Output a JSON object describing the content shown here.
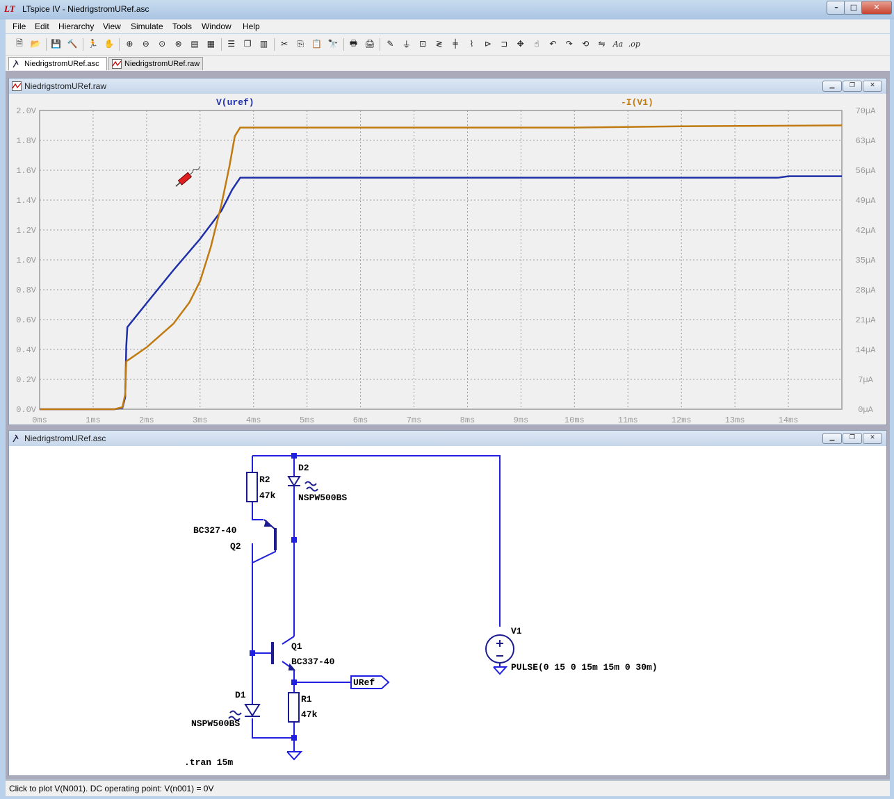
{
  "window": {
    "title": "LTspice IV - NiedrigstromURef.asc",
    "buttons": {
      "minimize": "–",
      "maximize": "□",
      "close": "✕"
    }
  },
  "menu": [
    "File",
    "Edit",
    "Hierarchy",
    "View",
    "Simulate",
    "Tools",
    "Window",
    "Help"
  ],
  "toolbar_icons": [
    "new-schematic-icon",
    "open-icon",
    "save-icon",
    "control-panel-icon",
    "run-icon",
    "halt-icon",
    "zoom-in-icon",
    "zoom-out-icon",
    "zoom-fit-icon",
    "zoom-cancel-icon",
    "autorange-icon",
    "grid-icon",
    "tile-horizontal-icon",
    "cascade-icon",
    "tile-vertical-icon",
    "cut-icon",
    "copy-icon",
    "paste-icon",
    "find-icon",
    "print-preview-icon",
    "print-icon",
    "wire-icon",
    "ground-icon",
    "label-net-icon",
    "resistor-icon",
    "capacitor-icon",
    "inductor-icon",
    "diode-icon",
    "component-icon",
    "move-icon",
    "drag-icon",
    "undo-icon",
    "redo-icon",
    "rotate-icon",
    "mirror-icon",
    "text-icon",
    "spice-directive-icon"
  ],
  "tabs": [
    "NiedrigstromURef.asc",
    "NiedrigstromURef.raw"
  ],
  "plot_window": {
    "title": "NiedrigstromURef.raw",
    "trace_labels": [
      "V(uref)",
      "-I(V1)"
    ],
    "colors": {
      "vuref": "#1f2fa8",
      "iv1": "#c07a10",
      "grid": "#9a9a9a",
      "axis_text": "#9a9a9a"
    }
  },
  "chart_data": {
    "type": "line",
    "title": "",
    "xlabel": "",
    "x_ticks": [
      "0ms",
      "1ms",
      "2ms",
      "3ms",
      "4ms",
      "5ms",
      "6ms",
      "7ms",
      "8ms",
      "9ms",
      "10ms",
      "11ms",
      "12ms",
      "13ms",
      "14ms"
    ],
    "y_left_ticks": [
      "0.0V",
      "0.2V",
      "0.4V",
      "0.6V",
      "0.8V",
      "1.0V",
      "1.2V",
      "1.4V",
      "1.6V",
      "1.8V",
      "2.0V"
    ],
    "y_right_ticks": [
      "0µA",
      "7µA",
      "14µA",
      "21µA",
      "28µA",
      "35µA",
      "42µA",
      "49µA",
      "56µA",
      "63µA",
      "70µA"
    ],
    "xlim_ms": [
      0,
      15
    ],
    "ylim_left_V": [
      0,
      2.0
    ],
    "ylim_right_uA": [
      0,
      70
    ],
    "grid": true,
    "series": [
      {
        "name": "V(uref)",
        "axis": "left",
        "color": "#1f2fa8",
        "points": [
          [
            0,
            0
          ],
          [
            1.4,
            0
          ],
          [
            1.55,
            0.01
          ],
          [
            1.6,
            0.08
          ],
          [
            1.62,
            0.42
          ],
          [
            1.64,
            0.55
          ],
          [
            2,
            0.71
          ],
          [
            2.5,
            0.93
          ],
          [
            3,
            1.14
          ],
          [
            3.4,
            1.33
          ],
          [
            3.6,
            1.47
          ],
          [
            3.75,
            1.55
          ],
          [
            6,
            1.55
          ],
          [
            10,
            1.55
          ],
          [
            13.8,
            1.55
          ],
          [
            14,
            1.56
          ],
          [
            15,
            1.56
          ]
        ]
      },
      {
        "name": "-I(V1)",
        "axis": "right",
        "color": "#c07a10",
        "points": [
          [
            0,
            0
          ],
          [
            1.4,
            0
          ],
          [
            1.55,
            0.5
          ],
          [
            1.6,
            3.5
          ],
          [
            1.62,
            11.2
          ],
          [
            2,
            14.5
          ],
          [
            2.5,
            20
          ],
          [
            2.8,
            25
          ],
          [
            3,
            30
          ],
          [
            3.2,
            38
          ],
          [
            3.4,
            48
          ],
          [
            3.55,
            57
          ],
          [
            3.65,
            64
          ],
          [
            3.75,
            66
          ],
          [
            6,
            66
          ],
          [
            10,
            66
          ],
          [
            12,
            66.3
          ],
          [
            15,
            66.5
          ]
        ]
      }
    ]
  },
  "schematic_window": {
    "title": "NiedrigstromURef.asc",
    "labels": {
      "r2_name": "R2",
      "r2_value": "47k",
      "d2_name": "D2",
      "d2_model": "NSPW500BS",
      "q2_model": "BC327-40",
      "q2_name": "Q2",
      "q1_name": "Q1",
      "q1_model": "BC337-40",
      "uref_label": "URef",
      "v1_name": "V1",
      "v1_value": "PULSE(0 15 0 15m 15m 0 30m)",
      "d1_name": "D1",
      "d1_model": "NSPW500BS",
      "r1_name": "R1",
      "r1_value": "47k",
      "directive": ".tran 15m"
    },
    "colors": {
      "wire": "#2020e0",
      "component": "#1c1c90",
      "text": "#000000"
    }
  },
  "status": {
    "text": "Click to plot V(N001).  DC operating point: V(n001) = 0V"
  }
}
